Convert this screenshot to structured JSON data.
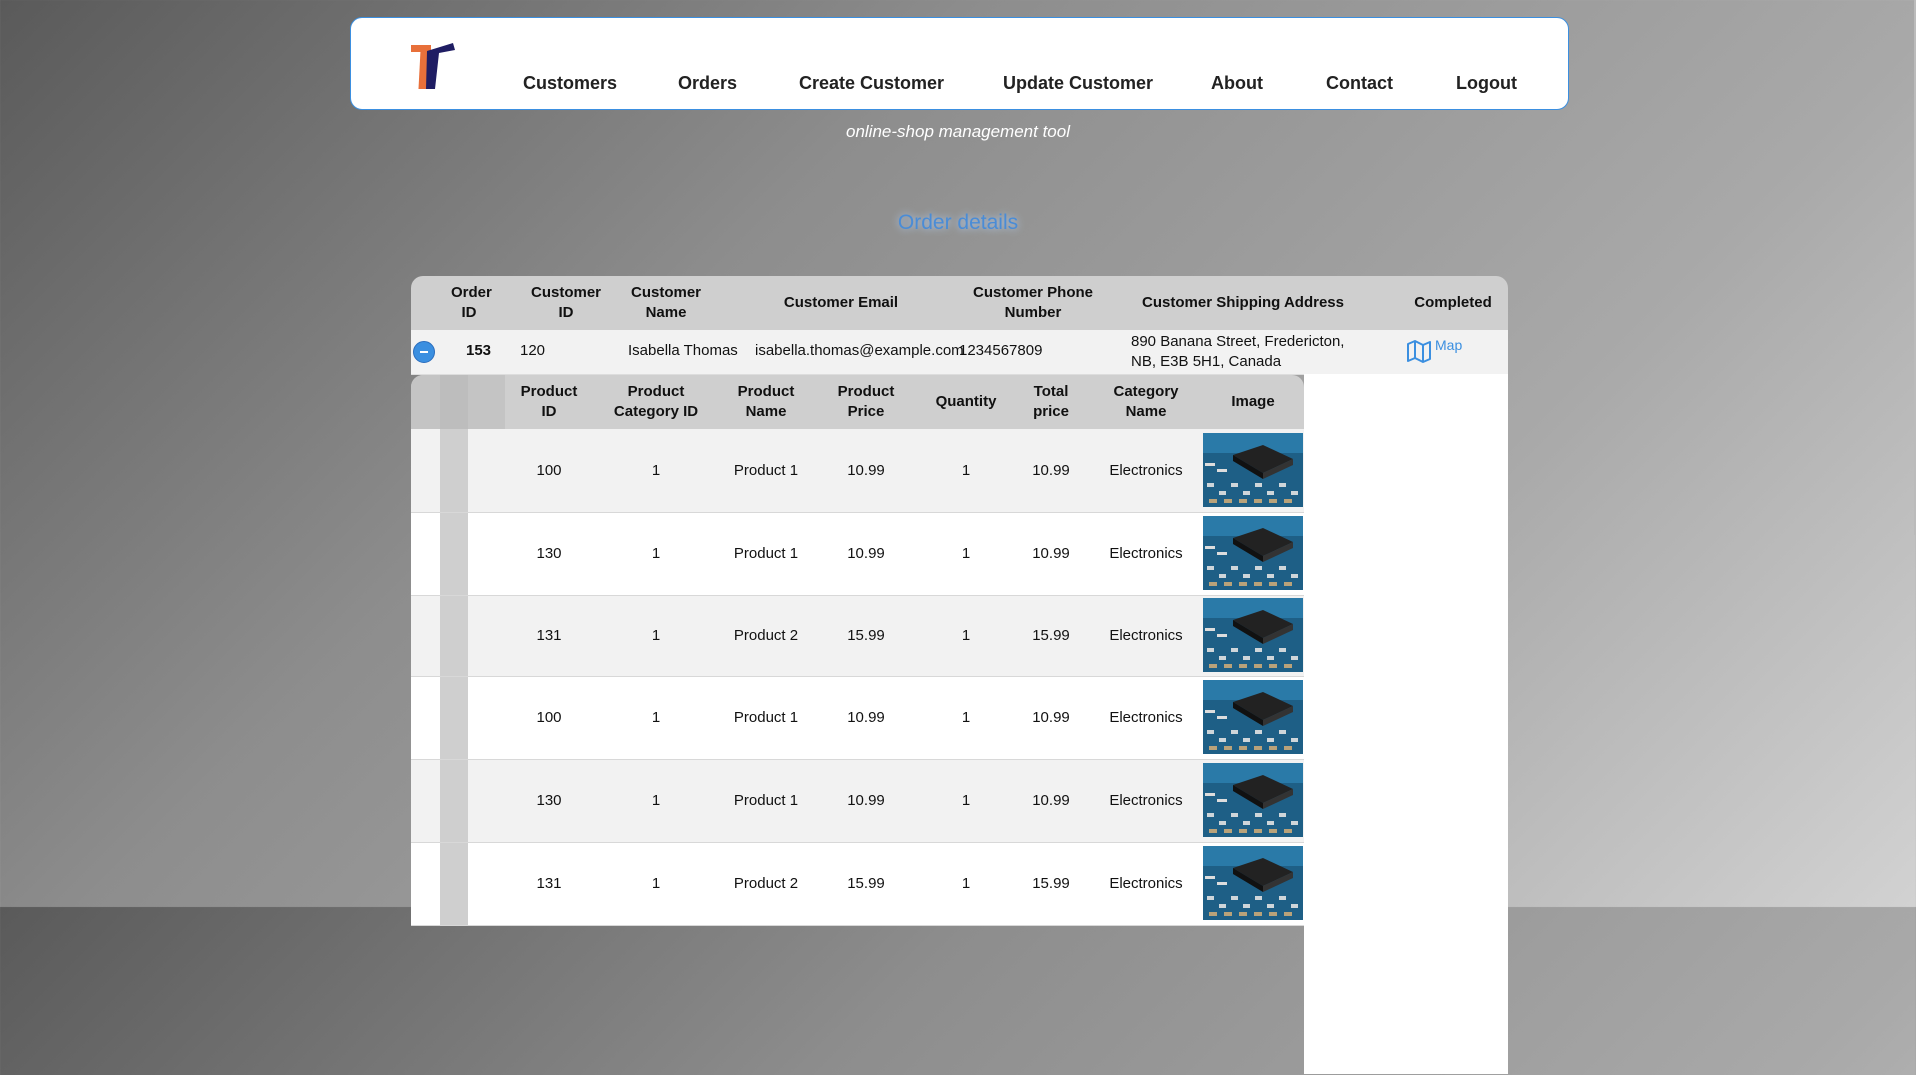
{
  "nav": {
    "items": [
      "Customers",
      "Orders",
      "Create Customer",
      "Update Customer",
      "About",
      "Contact",
      "Logout"
    ]
  },
  "tagline": "online-shop management tool",
  "page_title": "Order details",
  "order_table": {
    "headers": [
      "Order ID",
      "Customer ID",
      "Customer Name",
      "Customer Email",
      "Customer Phone Number",
      "Customer Shipping Address",
      "Completed"
    ],
    "row": {
      "order_id": "153",
      "customer_id": "120",
      "customer_name": "Isabella Thomas",
      "email": "isabella.thomas@example.com",
      "phone": "1234567809",
      "address": "890 Banana Street, Fredericton, NB, E3B 5H1, Canada",
      "map_label": "Map"
    }
  },
  "product_table": {
    "headers": [
      "Product ID",
      "Product Category ID",
      "Product Name",
      "Product Price",
      "Quantity",
      "Total price",
      "Category Name",
      "Image"
    ],
    "rows": [
      [
        "100",
        "1",
        "Product 1",
        "10.99",
        "1",
        "10.99",
        "Electronics"
      ],
      [
        "130",
        "1",
        "Product 1",
        "10.99",
        "1",
        "10.99",
        "Electronics"
      ],
      [
        "131",
        "1",
        "Product 2",
        "15.99",
        "1",
        "15.99",
        "Electronics"
      ],
      [
        "100",
        "1",
        "Product 1",
        "10.99",
        "1",
        "10.99",
        "Electronics"
      ],
      [
        "130",
        "1",
        "Product 1",
        "10.99",
        "1",
        "10.99",
        "Electronics"
      ],
      [
        "131",
        "1",
        "Product 2",
        "15.99",
        "1",
        "15.99",
        "Electronics"
      ]
    ]
  },
  "colors": {
    "accent": "#3b8fe0",
    "logo_orange": "#e8703a",
    "logo_navy": "#1f1d63"
  }
}
